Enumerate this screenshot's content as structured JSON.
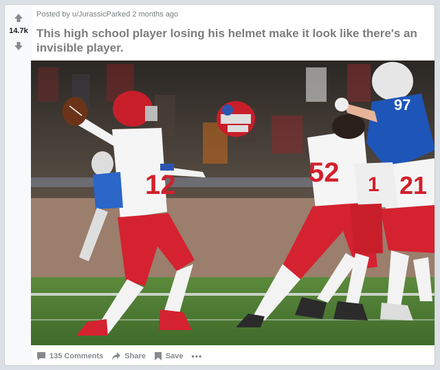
{
  "post": {
    "score": "14.7k",
    "meta_prefix": "Posted by",
    "author": "u/JurassicParked",
    "time": "2 months ago",
    "title": "This high school player losing his helmet make it look like there's an invisible player.",
    "jersey_numbers": [
      "12",
      "52",
      "97",
      "21",
      "1"
    ]
  },
  "actions": {
    "comments": "135 Comments",
    "share": "Share",
    "save": "Save",
    "more": "•••"
  },
  "icons": {
    "upvote": "arrow-up-icon",
    "downvote": "arrow-down-icon",
    "comments": "comment-bubble-icon",
    "share": "share-arrow-icon",
    "save": "bookmark-icon"
  },
  "colors": {
    "red_jersey": "#cc1f2a",
    "blue_jersey": "#1e55b8",
    "field": "#4d7a35"
  }
}
